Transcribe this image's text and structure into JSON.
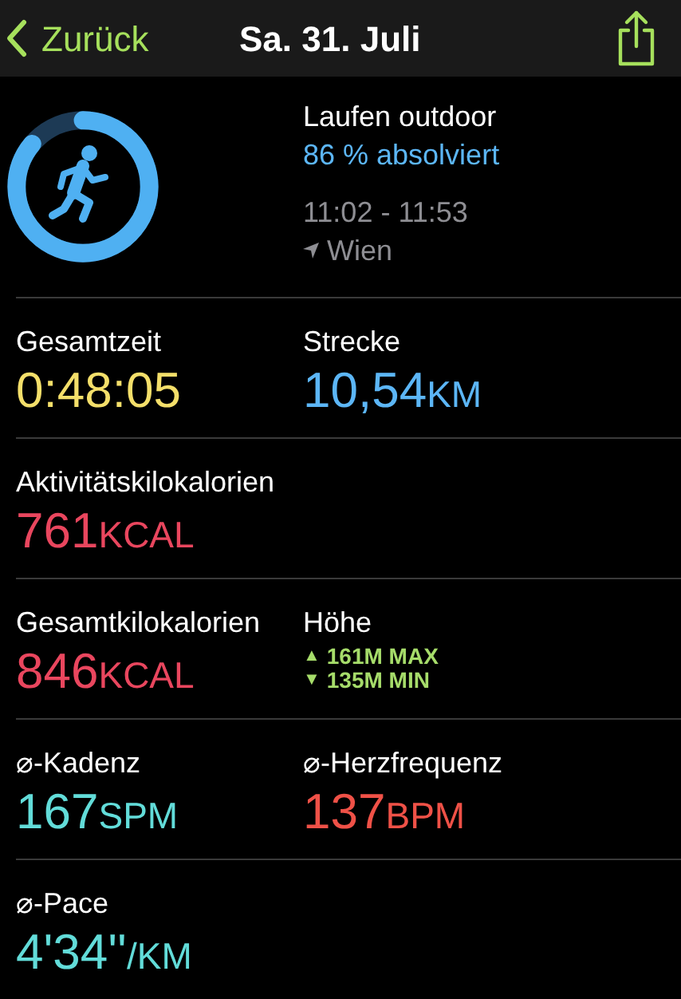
{
  "nav": {
    "back": "Zurück",
    "title": "Sa. 31. Juli"
  },
  "workout": {
    "name": "Laufen outdoor",
    "progress": "86 % absolviert",
    "level": 0.86,
    "time": "11:02 - 11:53",
    "location": "Wien"
  },
  "rows": [
    [
      {
        "kind": "value",
        "label": "Gesamtzeit",
        "value": "0:48:05",
        "color": "#f4df6a"
      },
      {
        "kind": "value",
        "label": "Strecke",
        "value": "10,54",
        "unit": "KM",
        "color": "#5cb6f6"
      }
    ],
    [
      {
        "kind": "value",
        "label": "Aktivitätskilokalorien",
        "value": "761",
        "unit": "KCAL",
        "color": "#e9465e"
      }
    ],
    [
      {
        "kind": "value",
        "label": "Gesamtkilokalorien",
        "value": "846",
        "unit": "KCAL",
        "color": "#e9465e"
      },
      {
        "kind": "elevation",
        "label": "Höhe",
        "max_arrow": "▲",
        "max": "161M MAX",
        "min_arrow": "▼",
        "min": "135M MIN",
        "color": "#a6dc6a"
      }
    ],
    [
      {
        "kind": "value",
        "label": "⌀-Kadenz",
        "value": "167",
        "unit": "SPM",
        "color": "#62dcd9"
      },
      {
        "kind": "value",
        "label": "⌀-Herzfrequenz",
        "value": "137",
        "unit": "BPM",
        "color": "#ef5147"
      }
    ],
    [
      {
        "kind": "value",
        "label": "⌀-Pace",
        "value": "4'34''",
        "unit": "/KM",
        "color": "#62dcd9"
      }
    ]
  ]
}
